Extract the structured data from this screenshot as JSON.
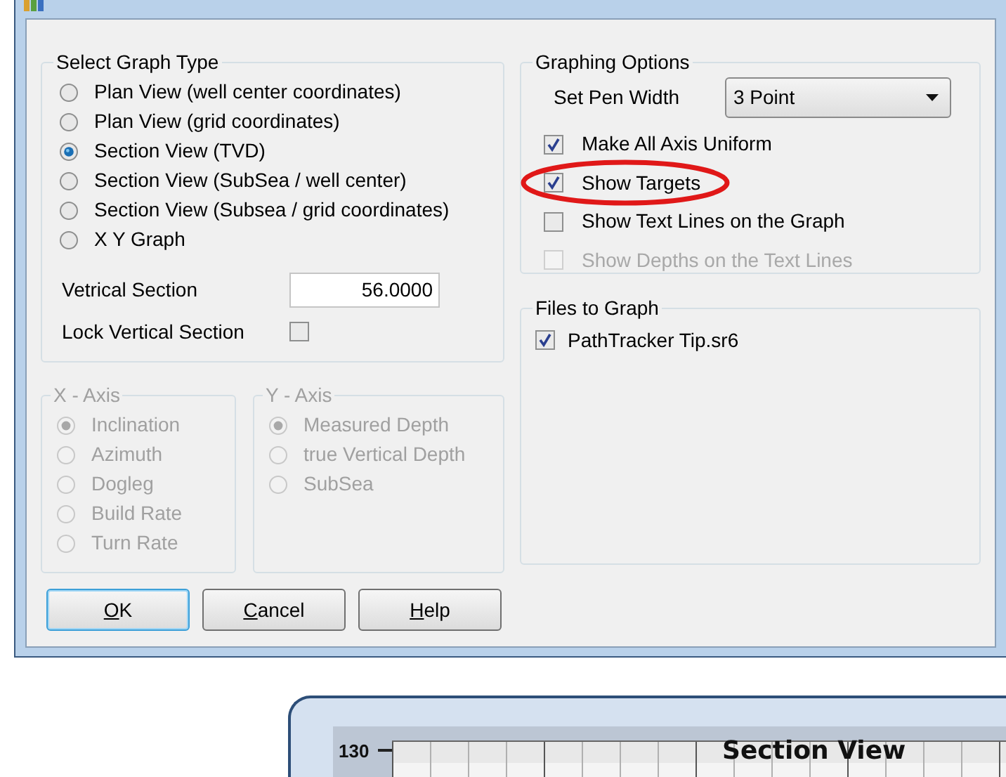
{
  "graph_type": {
    "legend": "Select Graph Type",
    "options": [
      {
        "label": "Plan View (well center coordinates)",
        "selected": false
      },
      {
        "label": "Plan View (grid coordinates)",
        "selected": false
      },
      {
        "label": "Section View (TVD)",
        "selected": true
      },
      {
        "label": "Section View (SubSea / well center)",
        "selected": false
      },
      {
        "label": "Section View (Subsea / grid coordinates)",
        "selected": false
      },
      {
        "label": "X Y Graph",
        "selected": false
      }
    ]
  },
  "vertical_section": {
    "label": "Vetrical Section",
    "value": "56.0000"
  },
  "lock_vertical_section": {
    "label": "Lock Vertical Section",
    "checked": false
  },
  "x_axis": {
    "legend": "X - Axis",
    "disabled": true,
    "options": [
      {
        "label": "Inclination",
        "selected": true
      },
      {
        "label": "Azimuth",
        "selected": false
      },
      {
        "label": "Dogleg",
        "selected": false
      },
      {
        "label": "Build Rate",
        "selected": false
      },
      {
        "label": "Turn Rate",
        "selected": false
      }
    ]
  },
  "y_axis": {
    "legend": "Y - Axis",
    "disabled": true,
    "options": [
      {
        "label": "Measured Depth",
        "selected": true
      },
      {
        "label": "true Vertical Depth",
        "selected": false
      },
      {
        "label": "SubSea",
        "selected": false
      }
    ]
  },
  "buttons": [
    {
      "label": "OK",
      "default": true
    },
    {
      "label": "Cancel",
      "default": false
    },
    {
      "label": "Help",
      "default": false
    }
  ],
  "graphing_options": {
    "legend": "Graphing Options",
    "pen_width": {
      "label": "Set Pen Width",
      "value": "3 Point"
    },
    "options": [
      {
        "label": "Make All Axis Uniform",
        "checked": true,
        "disabled": false,
        "circled": false
      },
      {
        "label": "Show Targets",
        "checked": true,
        "disabled": false,
        "circled": true
      },
      {
        "label": "Show Text Lines on the Graph",
        "checked": false,
        "disabled": false,
        "circled": false
      },
      {
        "label": "Show Depths on the Text Lines",
        "checked": false,
        "disabled": true,
        "circled": false
      }
    ]
  },
  "files_to_graph": {
    "legend": "Files to Graph",
    "files": [
      {
        "label": "PathTracker Tip.sr6",
        "checked": true
      }
    ]
  },
  "chart": {
    "title": "Section View",
    "y_tick": "130"
  }
}
